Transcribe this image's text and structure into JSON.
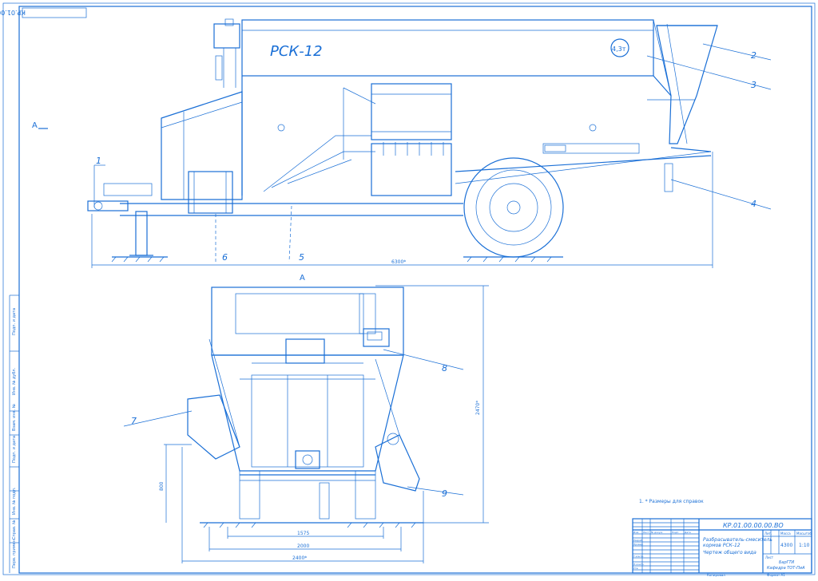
{
  "drawing": {
    "stamp_code_top": "КР.01.00.00.00.ВО",
    "view_marker": "A",
    "machine_label": "РСК-12",
    "capacity_badge": "4,3т",
    "callouts": [
      "1",
      "2",
      "3",
      "4",
      "5",
      "6",
      "7",
      "8",
      "9"
    ],
    "dim_overall_length": "6300*",
    "dim_height": "2470*",
    "dim_hitch_height": "800",
    "dim_track_inner": "1575",
    "dim_track_outer": "2000",
    "dim_width": "2400*",
    "note": "1. * Размеры для справок",
    "margin_labels": [
      "Подп. и дата",
      "Инв. № дубл.",
      "Взам. инв. №",
      "Подп. и дата",
      "Инв. № подл.",
      "Справ. №",
      "Перв. примен."
    ]
  },
  "title_block": {
    "code": "КР.01.00.00.00.ВО",
    "title_line1": "Разбрасыватель-смеситель",
    "title_line2": "кормов РСК-12",
    "title_line3": "Чертеж общего вида",
    "mass": "4300",
    "scale": "1:10",
    "sheet": "Лист",
    "org_line1": "БарГТИ",
    "org_line2": "Кафедра ТОТ-ПиА",
    "col_lit": "Лит.",
    "col_mass": "Масса",
    "col_scale": "Масштаб",
    "row_labels": [
      "Изм.",
      "Лист",
      "№ докум.",
      "Подп.",
      "Дата",
      "Разраб.",
      "Провер.",
      "Т.контр.",
      "Н.контр.",
      "Утв."
    ],
    "copied": "Копировал",
    "format": "Формат А1"
  },
  "colors": {
    "line": "#1a6fd6",
    "background": "#ffffff"
  }
}
